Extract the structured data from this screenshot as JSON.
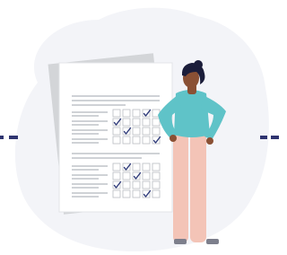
{
  "illustration": {
    "subject": "woman-reviewing-checklist",
    "icons": [
      "checklist-document-icon",
      "checkmark-icon",
      "person-icon"
    ]
  },
  "colors": {
    "blob_background": "#f3f4f8",
    "connector_line": "#2f3470",
    "back_paper": "#d3d5d8",
    "front_paper": "#ffffff",
    "text_line": "#cfd2d6",
    "checkbox_border": "#b9bcc2",
    "checkmark": "#2f3b7a",
    "shirt": "#5fc3c8",
    "pants": "#f3c4b7",
    "skin": "#8a5034",
    "hair": "#1b1d3a",
    "shoes": "#7d7f8c"
  },
  "checklist": {
    "top_checked_rows": [
      [
        3
      ],
      [
        0
      ],
      [
        1
      ],
      [
        4
      ]
    ],
    "bottom_checked_rows": [
      [
        1
      ],
      [
        2
      ],
      [
        0
      ],
      [
        3
      ]
    ]
  }
}
